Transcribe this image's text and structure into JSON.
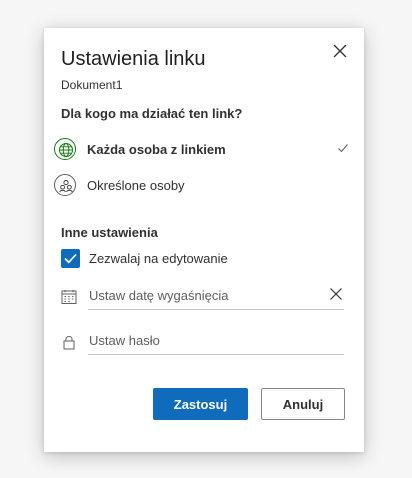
{
  "dialog": {
    "title": "Ustawienia linku",
    "subtitle": "Dokument1",
    "question": "Dla kogo ma działać ten link?",
    "options": [
      {
        "label": "Każda osoba z linkiem",
        "icon": "globe-icon",
        "selected": true
      },
      {
        "label": "Określone osoby",
        "icon": "people-icon",
        "selected": false
      }
    ],
    "other_settings": {
      "heading": "Inne ustawienia",
      "allow_edit": {
        "label": "Zezwalaj na edytowanie",
        "checked": true
      },
      "expiry": {
        "placeholder": "Ustaw datę wygaśnięcia",
        "value": ""
      },
      "password": {
        "placeholder": "Ustaw hasło",
        "value": ""
      }
    },
    "buttons": {
      "apply": "Zastosuj",
      "cancel": "Anuluj"
    }
  },
  "colors": {
    "accent": "#0f6cbd",
    "selected_green": "#107c10",
    "text": "#323130"
  }
}
